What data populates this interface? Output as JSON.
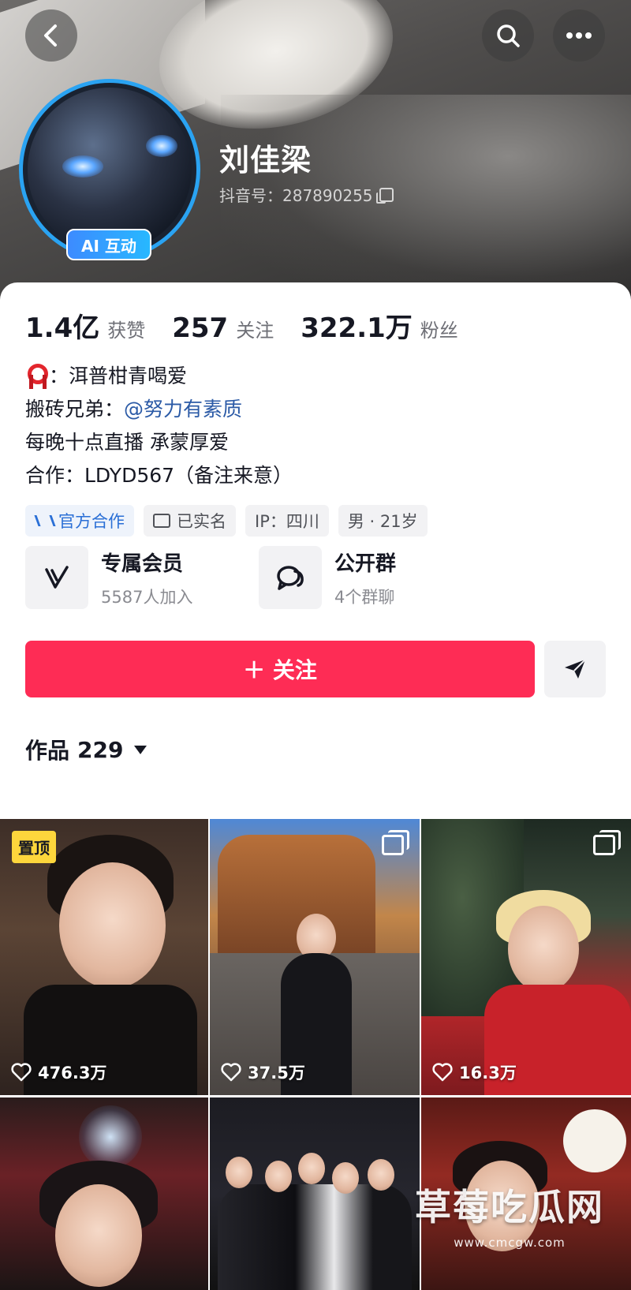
{
  "header": {
    "username": "刘佳梁",
    "douyin_id": "抖音号：287890255",
    "ai_badge": "AI 互动"
  },
  "stats": [
    {
      "value": "1.4亿",
      "label": "获赞"
    },
    {
      "value": "257",
      "label": "关注"
    },
    {
      "value": "322.1万",
      "label": "粉丝"
    }
  ],
  "bio": {
    "line1": "：洱普柑青喝爱",
    "line2_prefix": "搬砖兄弟：",
    "line2_mention": "@努力有素质",
    "line3": "每晚十点直播 承蒙厚爱",
    "line4": "合作：LDYD567（备注来意）"
  },
  "tags": [
    {
      "label": "官方合作",
      "icon": "cooperation-icon"
    },
    {
      "label": "已实名",
      "icon": "id-card-icon"
    },
    {
      "label": "IP：四川"
    },
    {
      "label": "男 · 21岁"
    }
  ],
  "features": [
    {
      "title": "专属会员",
      "subtitle": "5587人加入",
      "icon": "membership-v-icon"
    },
    {
      "title": "公开群",
      "subtitle": "4个群聊",
      "icon": "group-chat-icon"
    }
  ],
  "follow_label": "＋ 关注",
  "works": {
    "label": "作品",
    "count": "229"
  },
  "videos": [
    {
      "likes": "476.3万",
      "pinned": "置顶"
    },
    {
      "likes": "37.5万",
      "multi": true
    },
    {
      "likes": "16.3万",
      "multi": true
    },
    {},
    {},
    {}
  ],
  "watermark": {
    "main": "草莓吃瓜网",
    "sub": "www.cmcgw.com"
  },
  "colors": {
    "accent": "#fe2c55",
    "link": "#2b5aa6",
    "avatar_ring": "#2aa3f2",
    "pin_badge": "#fdd63c"
  }
}
